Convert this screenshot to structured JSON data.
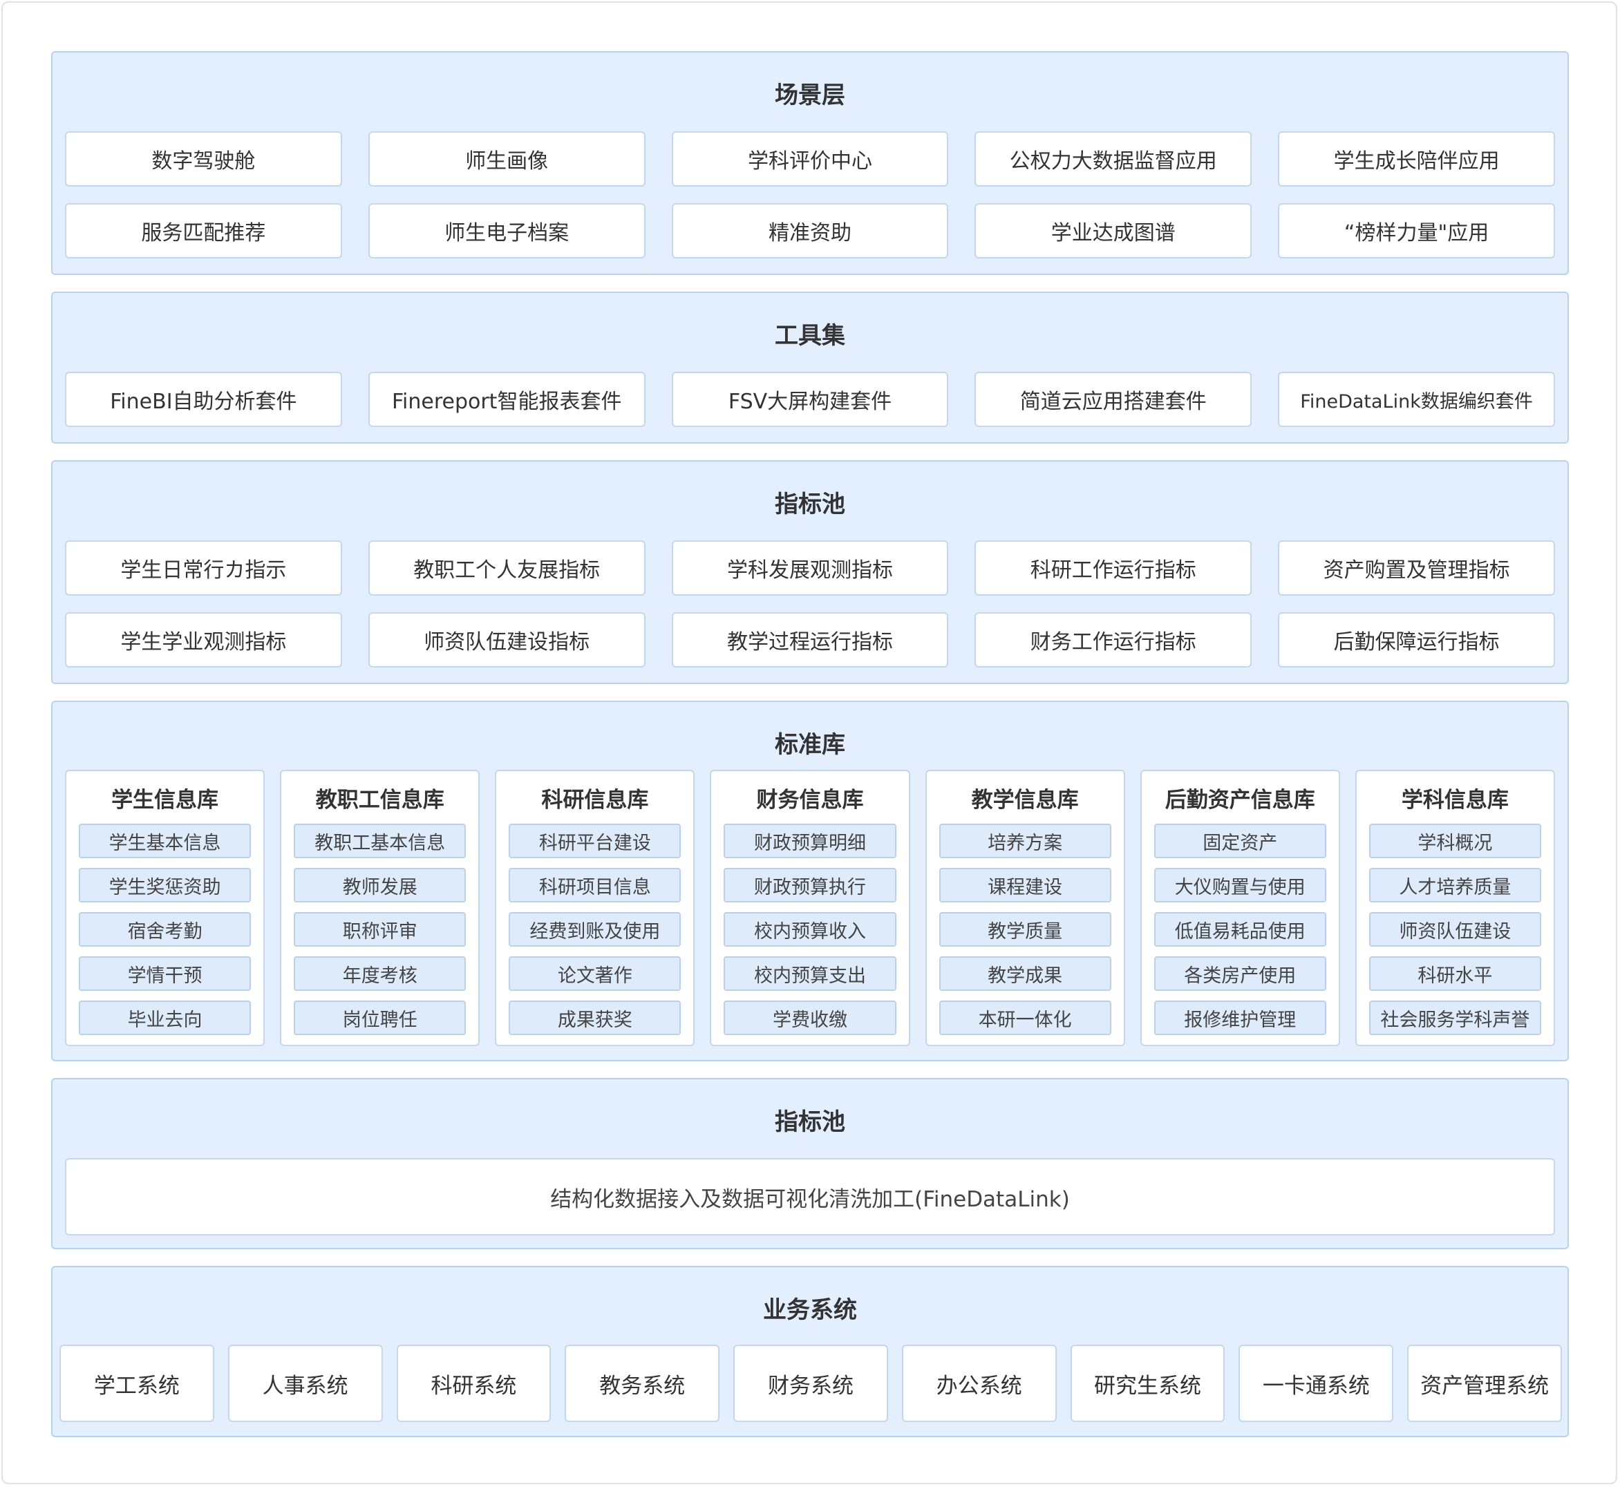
{
  "layers": {
    "scene": {
      "title": "场景层",
      "items": [
        "数字驾驶舱",
        "师生画像",
        "学科评价中心",
        "公权力大数据监督应用",
        "学生成长陪伴应用",
        "服务匹配推荐",
        "师生电子档案",
        "精准资助",
        "学业达成图谱",
        "“榜样力量\"应用"
      ]
    },
    "tools": {
      "title": "工具集",
      "items": [
        "FineBI自助分析套件",
        "Finereport智能报表套件",
        "FSV大屏构建套件",
        "简道云应用搭建套件",
        "FineDataLink数据编织套件"
      ]
    },
    "indicators": {
      "title": "指标池",
      "items": [
        "学生日常行カ指示",
        "教职工个人友展指标",
        "学科发展观测指标",
        "科研工作运行指标",
        "资产购置及管理指标",
        "学生学业观测指标",
        "师资队伍建设指标",
        "教学过程运行指标",
        "财务工作运行指标",
        "后勤保障运行指标"
      ]
    },
    "standard": {
      "title": "标准库",
      "libs": [
        {
          "title": "学生信息库",
          "items": [
            "学生基本信息",
            "学生奖惩资助",
            "宿舍考勤",
            "学情干预",
            "毕业去向"
          ]
        },
        {
          "title": "教职工信息库",
          "items": [
            "教职工基本信息",
            "教师发展",
            "职称评审",
            "年度考核",
            "岗位聘任"
          ]
        },
        {
          "title": "科研信息库",
          "items": [
            "科研平台建设",
            "科研项目信息",
            "经费到账及使用",
            "论文著作",
            "成果获奖"
          ]
        },
        {
          "title": "财务信息库",
          "items": [
            "财政预算明细",
            "财政预算执行",
            "校内预算收入",
            "校内预算支出",
            "学费收缴"
          ]
        },
        {
          "title": "教学信息库",
          "items": [
            "培养方案",
            "课程建设",
            "教学质量",
            "教学成果",
            "本研一体化"
          ]
        },
        {
          "title": "后勤资产信息库",
          "items": [
            "固定资产",
            "大仪购置与使用",
            "低值易耗品使用",
            "各类房产使用",
            "报修维护管理"
          ]
        },
        {
          "title": "学科信息库",
          "items": [
            "学科概况",
            "人才培养质量",
            "师资队伍建设",
            "科研水平",
            "社会服务学科声誉"
          ]
        }
      ]
    },
    "pool2": {
      "title": "指标池",
      "item": "结构化数据接入及数据可视化清洗加工(FineDataLink)"
    },
    "business": {
      "title": "业务系统",
      "items": [
        "学工系统",
        "人事系统",
        "科研系统",
        "教务系统",
        "财务系统",
        "办公系统",
        "研究生系统",
        "一卡通系统",
        "资产管理系统"
      ]
    }
  }
}
